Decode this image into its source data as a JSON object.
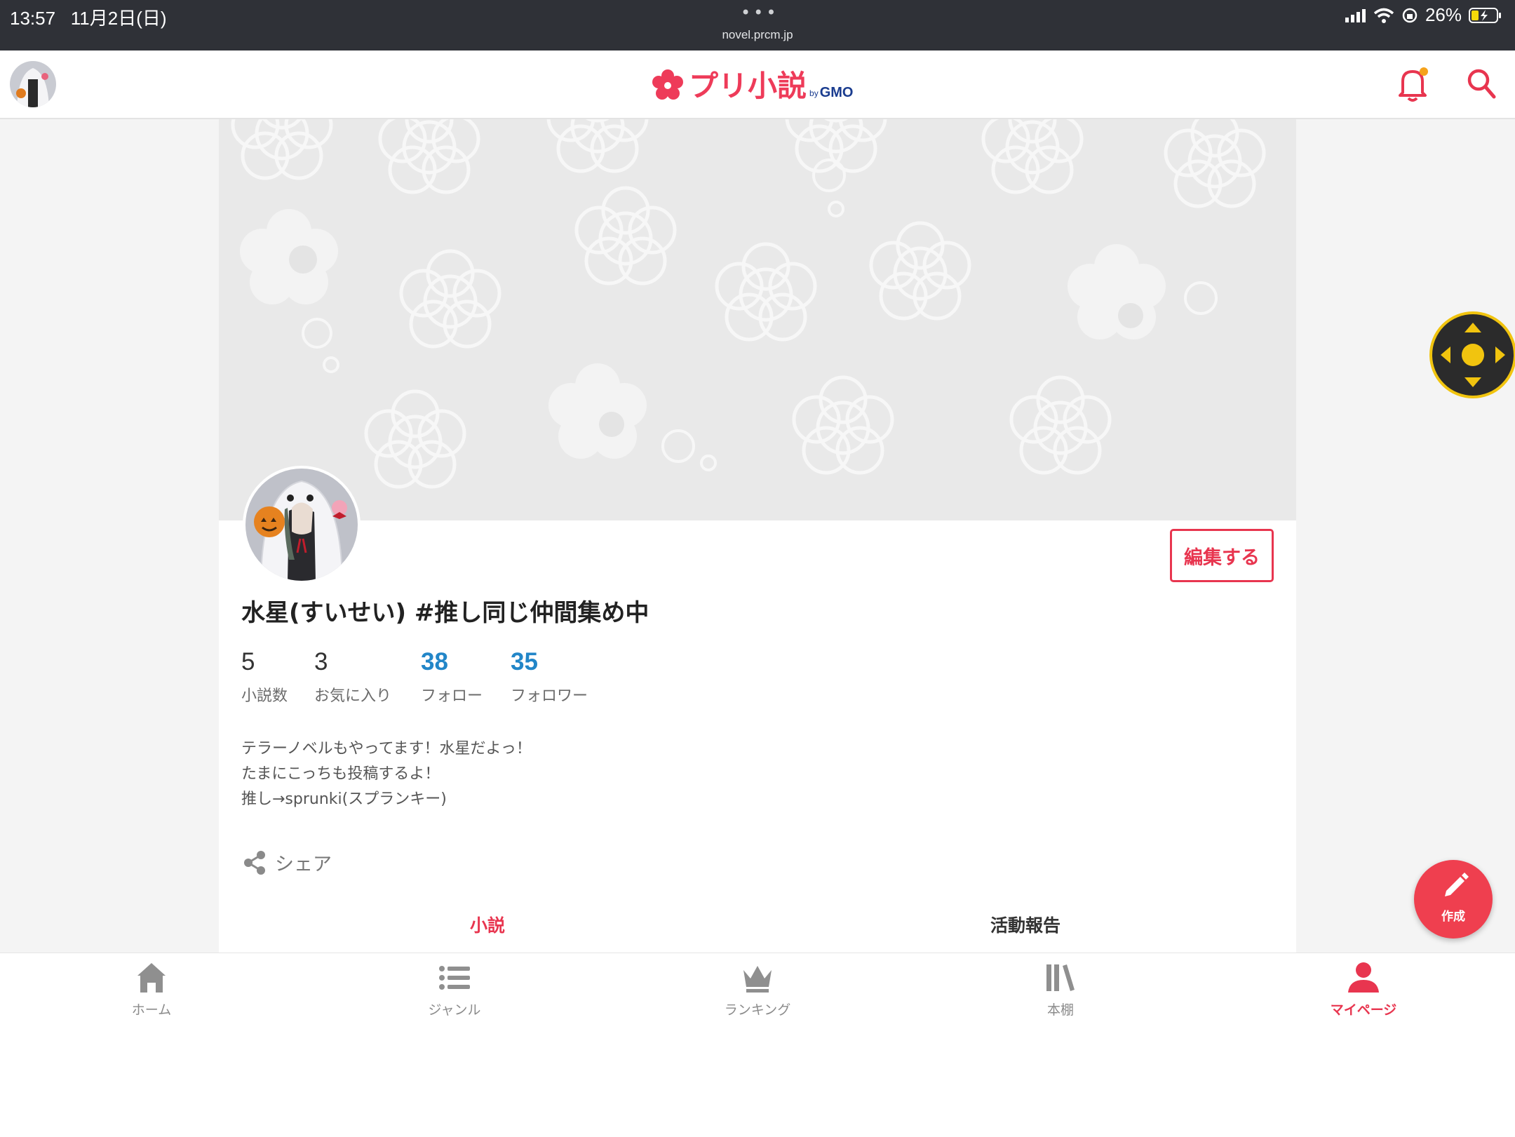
{
  "status_bar": {
    "time": "13:57",
    "date": "11月2日(日)",
    "url": "novel.prcm.jp",
    "battery": "26%"
  },
  "header": {
    "logo_text": "プリ小説",
    "logo_by": "by",
    "logo_brand": "GMO",
    "notification_dot_color": "#f5a21b"
  },
  "profile": {
    "name": "水星(すいせい) #推し同じ仲間集め中",
    "edit_label": "編集する",
    "stats": [
      {
        "value": "5",
        "label": "小説数"
      },
      {
        "value": "3",
        "label": "お気に入り"
      },
      {
        "value": "38",
        "label": "フォロー"
      },
      {
        "value": "35",
        "label": "フォロワー"
      }
    ],
    "bio": [
      "テラーノベルもやってます！水星だよっ！",
      "たまにこっちも投稿するよ！",
      "推し→sprunki(スプランキー)"
    ],
    "share_label": "シェア"
  },
  "tabs": {
    "novel": "小説",
    "activity": "活動報告"
  },
  "fab": {
    "create_label": "作成"
  },
  "bottom_nav": {
    "items": [
      {
        "label": "ホーム",
        "icon": "home-icon"
      },
      {
        "label": "ジャンル",
        "icon": "list-icon"
      },
      {
        "label": "ランキング",
        "icon": "crown-icon"
      },
      {
        "label": "本棚",
        "icon": "bookshelf-icon"
      },
      {
        "label": "マイページ",
        "icon": "person-icon",
        "active": true
      }
    ]
  },
  "colors": {
    "accent": "#e8354f",
    "stat_blue": "#2286c8",
    "status_bar": "#2f3137"
  }
}
